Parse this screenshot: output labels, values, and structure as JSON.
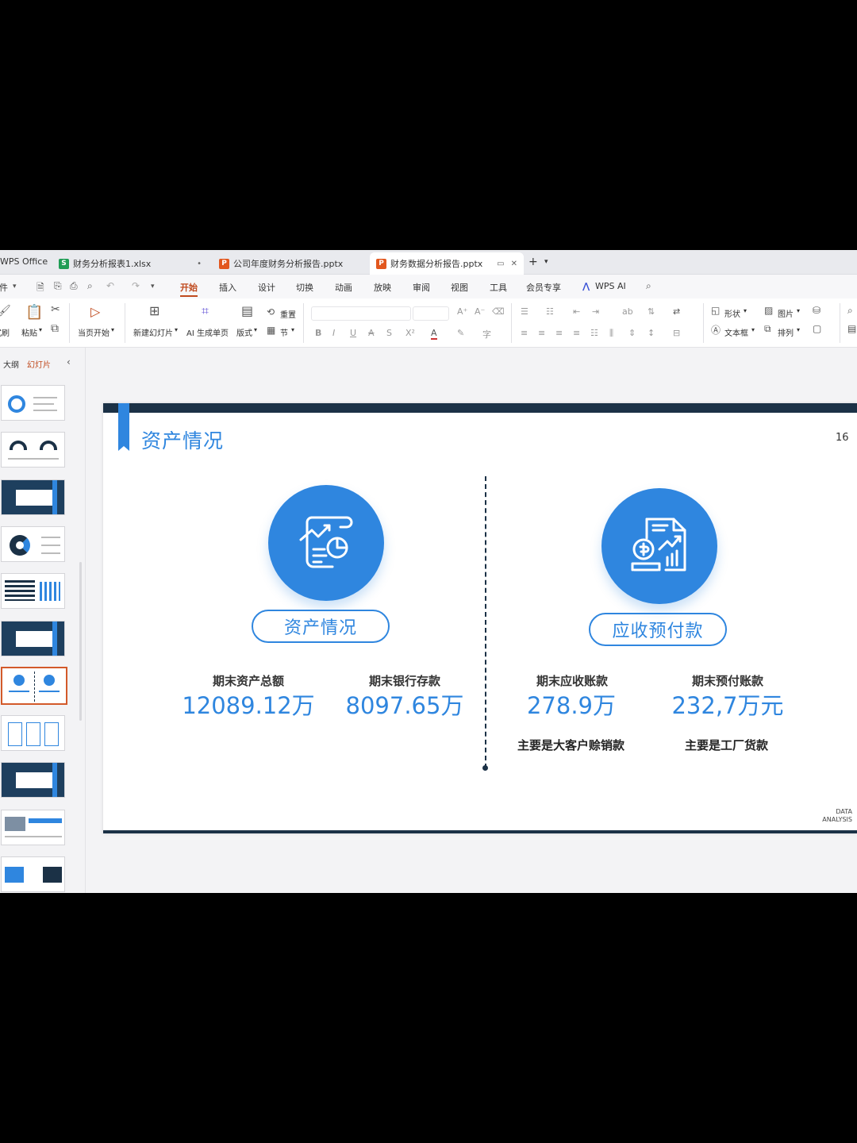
{
  "app": {
    "name": "WPS Office",
    "tabs": [
      {
        "label": "财务分析报表1.xlsx",
        "icon_letter": "S",
        "icon_color": "#1f9d55"
      },
      {
        "label": "公司年度财务分析报告.pptx",
        "icon_letter": "P",
        "icon_color": "#e2571e"
      },
      {
        "label": "财务数据分析报告.pptx",
        "icon_letter": "P",
        "icon_color": "#e2571e"
      }
    ],
    "new_tab": "+"
  },
  "menu": {
    "file": "文件",
    "items": [
      "开始",
      "插入",
      "设计",
      "切换",
      "动画",
      "放映",
      "审阅",
      "视图",
      "工具",
      "会员专享"
    ],
    "ai": "WPS AI"
  },
  "ribbon": {
    "format_painter": "格式刷",
    "paste": "粘贴",
    "play_from_current": "当页开始",
    "new_slide": "新建幻灯片",
    "ai_page": "AI 生成单页",
    "layout": "版式",
    "reset": "重置",
    "section": "节",
    "shape": "形状",
    "picture": "图片",
    "textbox": "文本框",
    "arrange": "排列"
  },
  "left_pane": {
    "outline_tab": "大纲",
    "slides_tab": "幻灯片"
  },
  "slide": {
    "title": "资产情况",
    "page_number": "16",
    "left": {
      "pill": "资产情况",
      "metrics": [
        {
          "label": "期末资产总额",
          "value": "12089.12万"
        },
        {
          "label": "期末银行存款",
          "value": "8097.65万"
        }
      ]
    },
    "right": {
      "pill": "应收预付款",
      "metrics": [
        {
          "label": "期末应收账款",
          "value": "278.9万",
          "note": "主要是大客户赊销款"
        },
        {
          "label": "期末预付账款",
          "value": "232,7万元",
          "note": "主要是工厂货款"
        }
      ]
    },
    "corner_tag_line1": "DATA",
    "corner_tag_line2": "ANALYSIS"
  },
  "colors": {
    "accent": "#2f86df",
    "dark_bar": "#1b3146",
    "active_menu": "#c04a1e"
  }
}
